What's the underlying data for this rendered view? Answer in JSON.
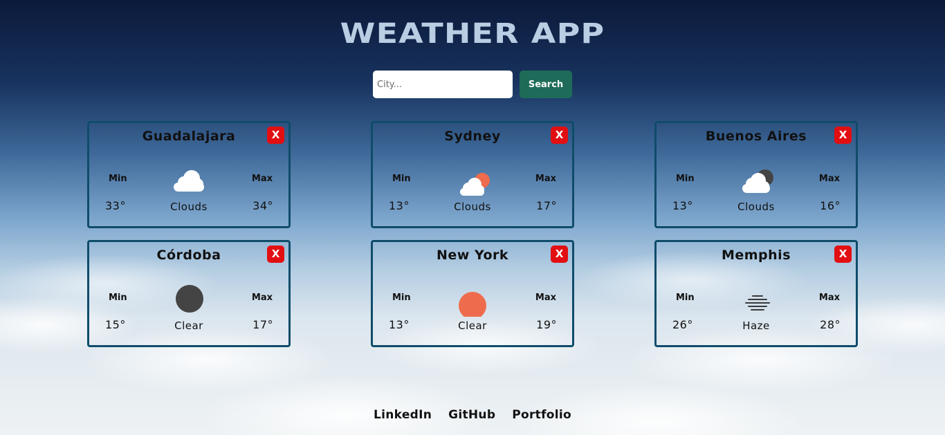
{
  "app": {
    "title": "WEATHER APP"
  },
  "search": {
    "placeholder": "City...",
    "value": "",
    "button_label": "Search"
  },
  "cards": [
    {
      "city": "Guadalajara",
      "min_label": "Min",
      "max_label": "Max",
      "min": "33°",
      "max": "34°",
      "description": "Clouds",
      "icon": "cloud-icon",
      "remove_label": "X"
    },
    {
      "city": "Sydney",
      "min_label": "Min",
      "max_label": "Max",
      "min": "13°",
      "max": "17°",
      "description": "Clouds",
      "icon": "cloud-sun-icon",
      "remove_label": "X"
    },
    {
      "city": "Buenos Aires",
      "min_label": "Min",
      "max_label": "Max",
      "min": "13°",
      "max": "16°",
      "description": "Clouds",
      "icon": "cloud-moon-icon",
      "remove_label": "X"
    },
    {
      "city": "Córdoba",
      "min_label": "Min",
      "max_label": "Max",
      "min": "15°",
      "max": "17°",
      "description": "Clear",
      "icon": "moon-icon",
      "remove_label": "X"
    },
    {
      "city": "New York",
      "min_label": "Min",
      "max_label": "Max",
      "min": "13°",
      "max": "19°",
      "description": "Clear",
      "icon": "sun-icon",
      "remove_label": "X"
    },
    {
      "city": "Memphis",
      "min_label": "Min",
      "max_label": "Max",
      "min": "26°",
      "max": "28°",
      "description": "Haze",
      "icon": "haze-icon",
      "remove_label": "X"
    }
  ],
  "footer": {
    "links": [
      "LinkedIn",
      "GitHub",
      "Portfolio"
    ]
  },
  "colors": {
    "sun": "#ee6c4d",
    "moon": "#444444",
    "remove": "#e20f12",
    "search_button": "#1f6b59",
    "card_border": "#0f4c6a",
    "title": "#b9cde3"
  }
}
